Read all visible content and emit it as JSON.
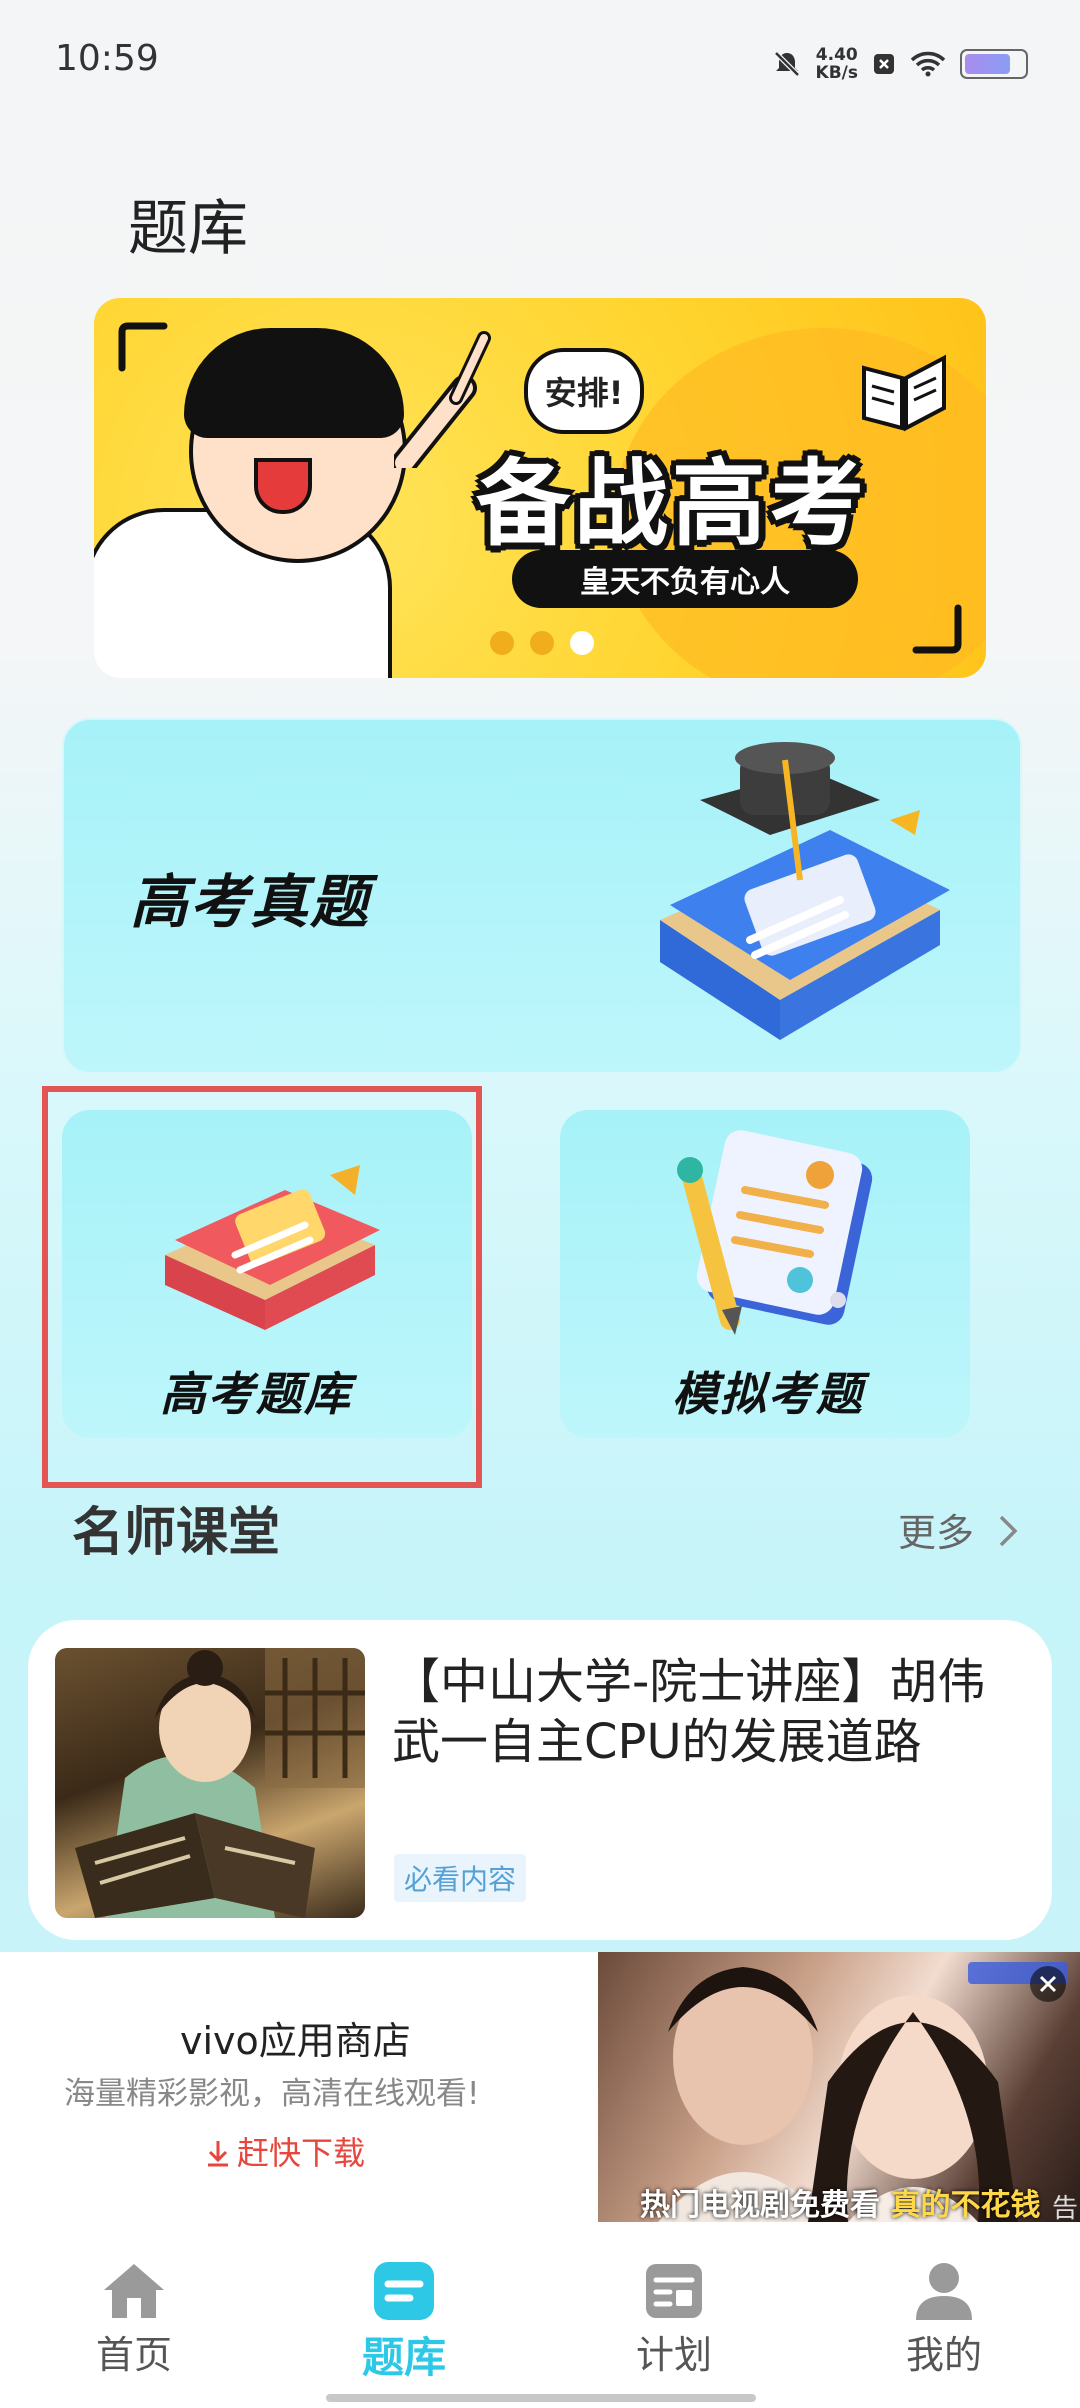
{
  "status": {
    "time": "10:59",
    "netspeed_value": "4.40",
    "netspeed_unit": "KB/s"
  },
  "page": {
    "title": "题库"
  },
  "banner": {
    "bubble": "安排!",
    "title": "备战高考",
    "subtitle": "皇天不负有心人",
    "active_dot": 3,
    "dot_count": 3
  },
  "cards": {
    "big": "高考真题",
    "small": [
      "高考题库",
      "模拟考题"
    ]
  },
  "section": {
    "title": "名师课堂",
    "more": "更多"
  },
  "course": {
    "title": "【中山大学-院士讲座】胡伟武一自主CPU的发展道路",
    "tag": "必看内容"
  },
  "ad": {
    "app_name": "vivo应用商店",
    "description": "海量精彩影视，高清在线观看!",
    "download": "赶快下载",
    "image_caption_a": "热门电视剧免费看 ",
    "image_caption_b": "真的不花钱",
    "tag": "告"
  },
  "nav": [
    {
      "label": "首页",
      "icon": "home-icon"
    },
    {
      "label": "题库",
      "icon": "question-bank-icon",
      "active": true
    },
    {
      "label": "计划",
      "icon": "plan-icon"
    },
    {
      "label": "我的",
      "icon": "profile-icon"
    }
  ],
  "colors": {
    "accent": "#2cc8e6",
    "highlight_border": "#e35454",
    "banner_yellow": "#ffd42e",
    "card_cyan": "#a6f2f8"
  }
}
